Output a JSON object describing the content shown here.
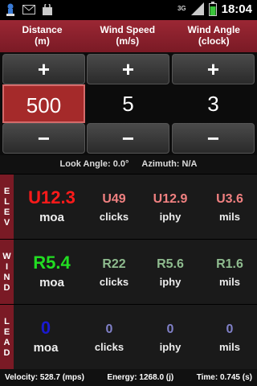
{
  "status": {
    "time": "18:04",
    "network": "3G",
    "icons": [
      "app-icon",
      "mail-icon",
      "shopping-bag-icon",
      "signal-icon",
      "battery-icon"
    ]
  },
  "header": {
    "distance_label_1": "Distance",
    "distance_label_2": "(m)",
    "wind_speed_label_1": "Wind Speed",
    "wind_speed_label_2": "(m/s)",
    "wind_angle_label_1": "Wind Angle",
    "wind_angle_label_2": "(clock)"
  },
  "steppers": {
    "plus": "+",
    "minus": "−",
    "distance": "500",
    "wind_speed": "5",
    "wind_angle": "3"
  },
  "info": {
    "look_angle": "Look Angle: 0.0°",
    "azimuth": "Azimuth: N/A"
  },
  "rows": {
    "elev": {
      "label": [
        "E",
        "L",
        "E",
        "V"
      ],
      "moa": "U12.3",
      "moa_unit": "moa",
      "clicks": "U49",
      "clicks_unit": "clicks",
      "iphy": "U12.9",
      "iphy_unit": "iphy",
      "mils": "U3.6",
      "mils_unit": "mils",
      "main_color": "#ff1a1a",
      "sub_color": "#f08080"
    },
    "wind": {
      "label": [
        "W",
        "I",
        "N",
        "D"
      ],
      "moa": "R5.4",
      "moa_unit": "moa",
      "clicks": "R22",
      "clicks_unit": "clicks",
      "iphy": "R5.6",
      "iphy_unit": "iphy",
      "mils": "R1.6",
      "mils_unit": "mils",
      "main_color": "#22dd22",
      "sub_color": "#8fbc8f"
    },
    "lead": {
      "label": [
        "L",
        "E",
        "A",
        "D"
      ],
      "moa": "0",
      "moa_unit": "moa",
      "clicks": "0",
      "clicks_unit": "clicks",
      "iphy": "0",
      "iphy_unit": "iphy",
      "mils": "0",
      "mils_unit": "mils",
      "main_color": "#1a1ad0",
      "sub_color": "#8080c8"
    }
  },
  "footer": {
    "velocity": "Velocity: 528.7 (mps)",
    "energy": "Energy: 1268.0 (j)",
    "time": "Time: 0.745 (s)"
  }
}
